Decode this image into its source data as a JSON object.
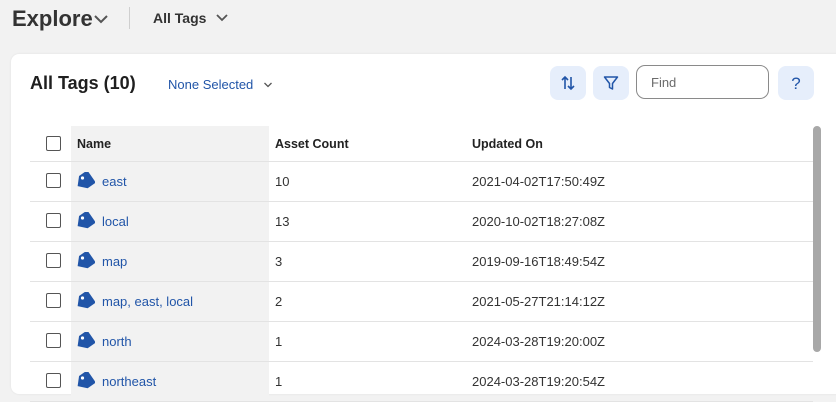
{
  "topbar": {
    "app_title": "Explore",
    "view_label": "All Tags"
  },
  "card": {
    "title": "All Tags (10)",
    "selection_label": "None Selected",
    "find_placeholder": "Find",
    "help_label": "?"
  },
  "table": {
    "columns": [
      "Name",
      "Asset Count",
      "Updated On"
    ],
    "rows": [
      {
        "name": "east",
        "asset_count": "10",
        "updated_on": "2021-04-02T17:50:49Z"
      },
      {
        "name": "local",
        "asset_count": "13",
        "updated_on": "2020-10-02T18:27:08Z"
      },
      {
        "name": "map",
        "asset_count": "3",
        "updated_on": "2019-09-16T18:49:54Z"
      },
      {
        "name": "map, east, local",
        "asset_count": "2",
        "updated_on": "2021-05-27T21:14:12Z"
      },
      {
        "name": "north",
        "asset_count": "1",
        "updated_on": "2024-03-28T19:20:00Z"
      },
      {
        "name": "northeast",
        "asset_count": "1",
        "updated_on": "2024-03-28T19:20:54Z"
      }
    ]
  },
  "icons": {
    "sort": "sort-icon",
    "filter": "filter-icon",
    "tag": "tag-icon",
    "chevron": "chevron-down-icon"
  },
  "colors": {
    "accent": "#2155a8",
    "button_bg": "#e6eefb",
    "page_bg": "#f2f2f2"
  }
}
